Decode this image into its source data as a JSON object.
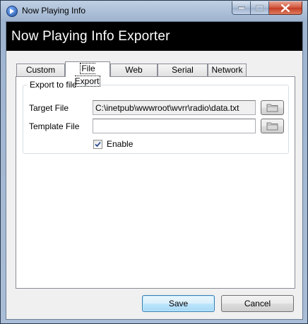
{
  "window": {
    "title": "Now Playing Info",
    "header_title": "Now Playing Info Exporter"
  },
  "tabs": [
    {
      "label": "Custom Title",
      "active": false
    },
    {
      "label": "File Export",
      "active": true
    },
    {
      "label": "Web Export",
      "active": false
    },
    {
      "label": "Serial Export",
      "active": false
    },
    {
      "label": "Network",
      "active": false
    }
  ],
  "file_export": {
    "group_label": "Export to file",
    "target_file_label": "Target File",
    "target_file_value": "C:\\inetpub\\wwwroot\\wvrr\\radio\\data.txt",
    "template_file_label": "Template File",
    "template_file_value": "",
    "enable_label": "Enable",
    "enable_checked": true
  },
  "buttons": {
    "save_label": "Save",
    "cancel_label": "Cancel"
  },
  "colors": {
    "header_bg": "#000000",
    "header_text": "#ffffff",
    "close_button": "#c8452b"
  }
}
